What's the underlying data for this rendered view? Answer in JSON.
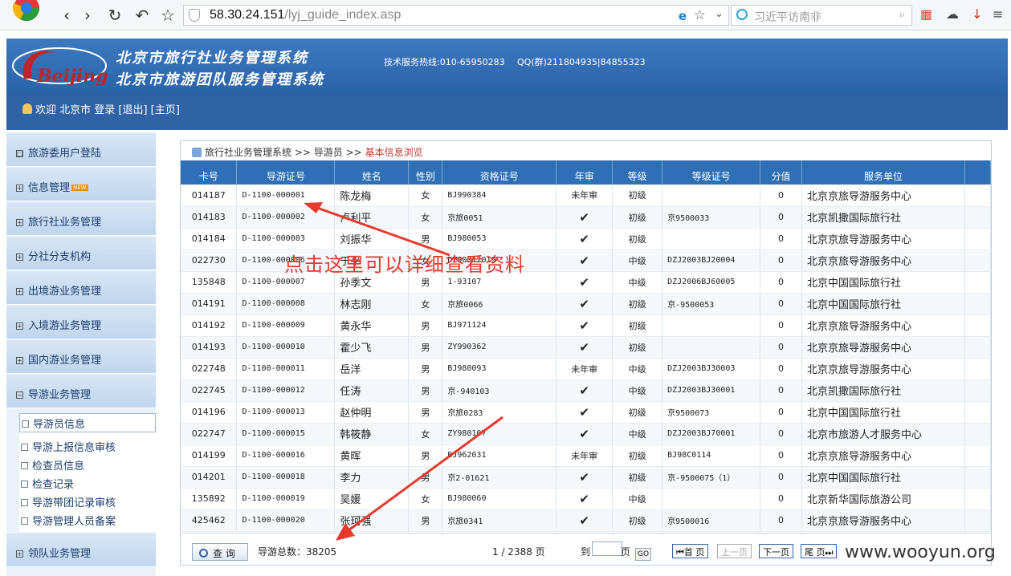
{
  "browser": {
    "url_host": "58.30.24.151",
    "url_path": "/lyj_guide_index.asp",
    "search_placeholder": "习近平访南非"
  },
  "header": {
    "title_line1": "北京市旅行社业务管理系统",
    "title_line2": "北京市旅游团队服务管理系统",
    "hotline": "技术服务热线:010-65950283",
    "qq": "QQ(群)211804935|84855323",
    "logo_text": "Beijing",
    "welcome": "欢迎 北京市 登录 [退出] [主页]"
  },
  "sidebar": {
    "items": [
      {
        "label": "旅游委用户登陆",
        "marker": "□"
      },
      {
        "label": "信息管理",
        "marker": "+",
        "badge": "NEW"
      },
      {
        "label": "旅行社业务管理",
        "marker": "+"
      },
      {
        "label": "分社分支机构",
        "marker": "+"
      },
      {
        "label": "出境游业务管理",
        "marker": "+"
      },
      {
        "label": "入境游业务管理",
        "marker": "+"
      },
      {
        "label": "国内游业务管理",
        "marker": "+"
      },
      {
        "label": "导游业务管理",
        "marker": "−"
      },
      {
        "label": "领队业务管理",
        "marker": "+"
      }
    ],
    "sub_items": [
      {
        "label": "导游员信息",
        "active": true
      },
      {
        "label": "导游上报信息审核"
      },
      {
        "label": "检查员信息"
      },
      {
        "label": "检查记录"
      },
      {
        "label": "导游带团记录审核"
      },
      {
        "label": "导游管理人员备案"
      }
    ]
  },
  "breadcrumb": {
    "part1": "旅行社业务管理系统",
    "sep": ">>",
    "part2": "导游员",
    "current": "基本信息浏览"
  },
  "table": {
    "headers": [
      "卡号",
      "导游证号",
      "姓名",
      "性别",
      "资格证号",
      "年审",
      "等级",
      "等级证号",
      "分值",
      "服务单位"
    ],
    "rows": [
      [
        "014187",
        "D-1100-000001",
        "陈龙梅",
        "女",
        "BJ990384",
        "未年审",
        "初级",
        "",
        "0",
        "北京京旅导游服务中心"
      ],
      [
        "014183",
        "D-1100-000002",
        "卢利平",
        "女",
        "京旅0051",
        "✔",
        "初级",
        "京9500033",
        "0",
        "北京凯撒国际旅行社"
      ],
      [
        "014184",
        "D-1100-000003",
        "刘振华",
        "男",
        "BJ980053",
        "✔",
        "初级",
        "",
        "0",
        "北京京旅导游服务中心"
      ],
      [
        "022730",
        "D-1100-000006",
        "于平",
        "女",
        "DZ90012019",
        "✔",
        "中级",
        "DZJ2003BJ20004",
        "0",
        "北京京旅导游服务中心"
      ],
      [
        "135848",
        "D-1100-000007",
        "孙季文",
        "男",
        "1-93107",
        "✔",
        "中级",
        "DZJ2006BJ60005",
        "0",
        "北京中国国际旅行社"
      ],
      [
        "014191",
        "D-1100-000008",
        "林志刚",
        "女",
        "京旅0066",
        "✔",
        "初级",
        "京-9500053",
        "0",
        "北京中国国际旅行社"
      ],
      [
        "014192",
        "D-1100-000009",
        "黄永华",
        "男",
        "BJ971124",
        "✔",
        "初级",
        "",
        "0",
        "北京京旅导游服务中心"
      ],
      [
        "014193",
        "D-1100-000010",
        "霍少飞",
        "男",
        "ZY990362",
        "✔",
        "初级",
        "",
        "0",
        "北京京旅导游服务中心"
      ],
      [
        "022748",
        "D-1100-000011",
        "岳洋",
        "男",
        "BJ980093",
        "未年审",
        "中级",
        "DZJ2003BJ30003",
        "0",
        "北京京旅导游服务中心"
      ],
      [
        "022745",
        "D-1100-000012",
        "任涛",
        "男",
        "京-940103",
        "✔",
        "中级",
        "DZJ2003BJ30001",
        "0",
        "北京凯撒国际旅行社"
      ],
      [
        "014196",
        "D-1100-000013",
        "赵仲明",
        "男",
        "京旅0283",
        "✔",
        "初级",
        "京9500073",
        "0",
        "北京中国国际旅行社"
      ],
      [
        "022747",
        "D-1100-000015",
        "韩筱静",
        "女",
        "ZY980107",
        "✔",
        "中级",
        "DZJ2003BJ70001",
        "0",
        "北京市旅游人才服务中心"
      ],
      [
        "014199",
        "D-1100-000016",
        "黄晖",
        "男",
        "BJ962031",
        "未年审",
        "初级",
        "BJ98C0114",
        "0",
        "北京京旅导游服务中心"
      ],
      [
        "014201",
        "D-1100-000018",
        "李力",
        "男",
        "京2-01621",
        "✔",
        "初级",
        "京-9500075（1）",
        "0",
        "北京中国国际旅行社"
      ],
      [
        "135892",
        "D-1100-000019",
        "吴媛",
        "女",
        "BJ980060",
        "✔",
        "中级",
        "",
        "0",
        "北京新华国际旅游公司"
      ],
      [
        "425462",
        "D-1100-000020",
        "张珂强",
        "男",
        "京旅0341",
        "✔",
        "初级",
        "京9500016",
        "0",
        "北京京旅导游服务中心"
      ]
    ]
  },
  "footer": {
    "query_label": "查 询",
    "total_label": "导游总数：38205",
    "paging": "1 / 2388 页",
    "goto_label": "到",
    "goto_unit": "页",
    "go": "GO",
    "first": "首 页",
    "prev": "上一页",
    "next": "下一页",
    "last": "尾 页"
  },
  "annotation": "点击这里可以详细查看资料",
  "watermark": "www.wooyun.org",
  "colors": {
    "header_blue": "#2f6fb6",
    "unaudited_red": "#d0021b",
    "check_orange": "#f08c00",
    "annotation_red": "#e8392c"
  }
}
